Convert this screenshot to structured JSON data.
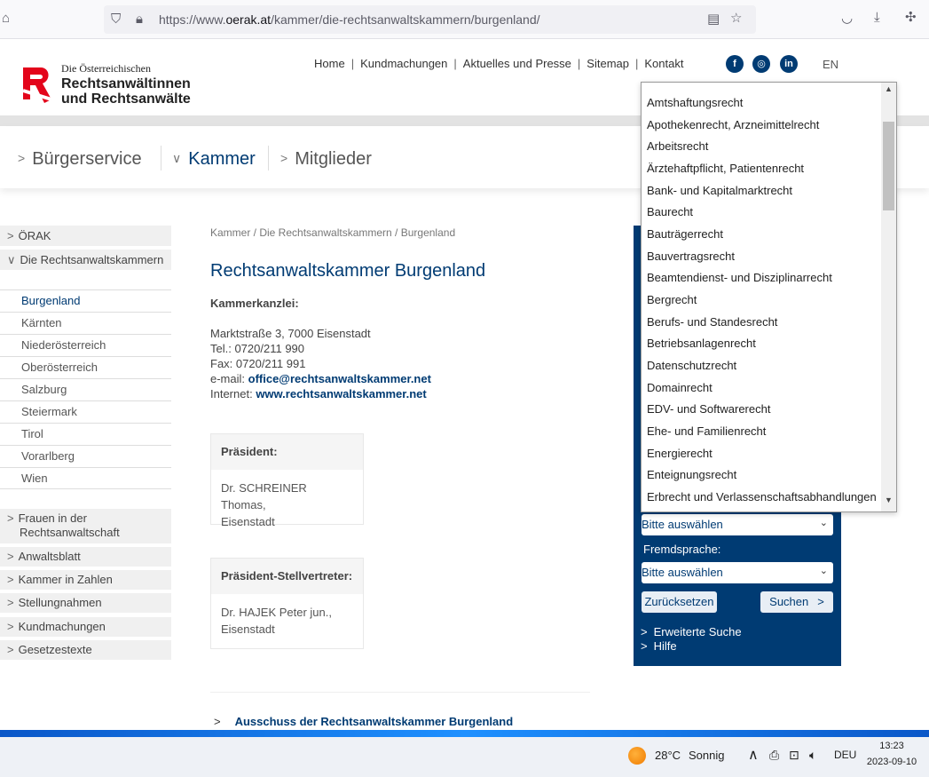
{
  "browser": {
    "url_prefix": "https://www.",
    "url_domain": "oerak.at",
    "url_path": "/kammer/die-rechtsanwaltskammern/burgenland/"
  },
  "logo": {
    "line1": "Die Österreichischen",
    "line2": "Rechtsanwältinnen",
    "line3": "und Rechtsanwälte"
  },
  "topnav": [
    "Home",
    "Kundmachungen",
    "Aktuelles und Presse",
    "Sitemap",
    "Kontakt"
  ],
  "social": {
    "facebook": "f",
    "instagram": "◎",
    "linkedin": "in"
  },
  "language": "EN",
  "mainnav": [
    "Bürgerservice",
    "Kammer",
    "Mitglieder"
  ],
  "sidebar": {
    "top_groups": [
      "ÖRAK",
      "Die Rechtsanwaltskammern"
    ],
    "sub_items": [
      "Burgenland",
      "Kärnten",
      "Niederösterreich",
      "Oberösterreich",
      "Salzburg",
      "Steiermark",
      "Tirol",
      "Vorarlberg",
      "Wien"
    ],
    "bottom_groups": [
      {
        "line1": "Frauen in der",
        "line2": "Rechtsanwaltschaft"
      },
      {
        "line1": "Anwaltsblatt"
      },
      {
        "line1": "Kammer in Zahlen"
      },
      {
        "line1": "Stellungnahmen"
      },
      {
        "line1": "Kundmachungen"
      },
      {
        "line1": "Gesetzestexte"
      }
    ]
  },
  "content": {
    "breadcrumb": "Kammer / Die Rechtsanwaltskammern / Burgenland",
    "title": "Rechtsanwaltskammer Burgenland",
    "kanzlei_label": "Kammerkanzlei:",
    "address": "Marktstraße 3, 7000 Eisenstadt",
    "tel": "Tel.: 0720/211 990",
    "fax": "Fax: 0720/211 991",
    "email_label": "e-mail: ",
    "email": "office@rechtsanwaltskammer.net",
    "internet_label": "Internet: ",
    "internet": "www.rechtsanwaltskammer.net",
    "praesident_head": "Präsident:",
    "praesident_name": "Dr. SCHREINER Thomas,",
    "praesident_city": "Eisenstadt",
    "stellv_head": "Präsident-Stellvertreter:",
    "stellv_name": "Dr. HAJEK Peter jun.,",
    "stellv_city": "Eisenstadt",
    "ausschuss": "Ausschuss der Rechtsanwaltskammer Burgenland"
  },
  "search": {
    "select1": "Bitte auswählen",
    "fremdsprache_label": "Fremdsprache:",
    "select2": "Bitte auswählen",
    "reset": "Zurücksetzen",
    "submit": "Suchen",
    "advanced": "Erweiterte Suche",
    "help": "Hilfe"
  },
  "dropdown": {
    "options": [
      "Amtshaftungsrecht",
      "Apothekenrecht, Arzneimittelrecht",
      "Arbeitsrecht",
      "Ärztehaftpflicht, Patientenrecht",
      "Bank- und Kapitalmarktrecht",
      "Baurecht",
      "Bauträgerrecht",
      "Bauvertragsrecht",
      "Beamtendienst- und Disziplinarrecht",
      "Bergrecht",
      "Berufs- und Standesrecht",
      "Betriebsanlagenrecht",
      "Datenschutzrecht",
      "Domainrecht",
      "EDV- und Softwarerecht",
      "Ehe- und Familienrecht",
      "Energierecht",
      "Enteignungsrecht",
      "Erbrecht und Verlassenschaftsabhandlungen"
    ]
  },
  "taskbar": {
    "temp": "28°C",
    "weather": "Sonnig",
    "lang": "DEU",
    "time": "13:23",
    "date": "2023-09-10"
  }
}
